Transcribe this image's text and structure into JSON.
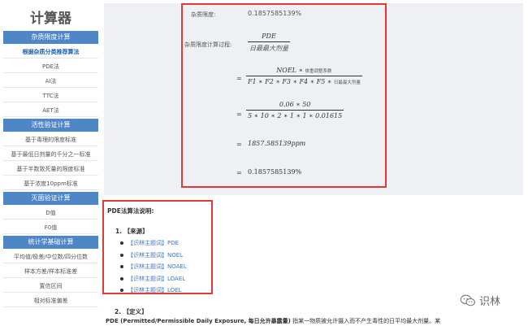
{
  "sidebar": {
    "title": "计算器",
    "menu": [
      {
        "type": "section",
        "label": "杂质限度计算"
      },
      {
        "type": "item",
        "label": "根据杂质分类推荐算法",
        "active": true
      },
      {
        "type": "item",
        "label": "PDE法"
      },
      {
        "type": "item",
        "label": "AI法"
      },
      {
        "type": "item",
        "label": "TTC法"
      },
      {
        "type": "item",
        "label": "AET法"
      },
      {
        "type": "section",
        "label": "活性验证计算"
      },
      {
        "type": "item",
        "label": "基于毒理的限度标准"
      },
      {
        "type": "item",
        "label": "基于最低日剂量的千分之一标准"
      },
      {
        "type": "item",
        "label": "基于半数致死量的限度标准"
      },
      {
        "type": "item",
        "label": "基于浓度10ppm标准"
      },
      {
        "type": "section",
        "label": "灭菌验证计算"
      },
      {
        "type": "item",
        "label": "D值"
      },
      {
        "type": "item",
        "label": "F0值"
      },
      {
        "type": "section",
        "label": "统计学基础计算"
      },
      {
        "type": "item",
        "label": "平均值/极差/中位数/四分位数"
      },
      {
        "type": "item",
        "label": "样本方差/样本标准差"
      },
      {
        "type": "item",
        "label": "置信区间"
      },
      {
        "type": "item",
        "label": "相对标准偏差"
      }
    ]
  },
  "calc": {
    "limit_label": "杂质限度:",
    "limit_value": "0.1857585139%",
    "process_label": "杂质限度计算过程:",
    "eq": "=",
    "step1_num": "PDE",
    "step1_den": "日最最大剂量",
    "step2_num_math": "NOEL",
    "step2_num_star": " ∗ ",
    "step2_num_note": "体重调整系数",
    "step2_den_math": "F1 ∗ F2 ∗ F3 ∗ F4 ∗ F5 ∗ ",
    "step2_den_note": "日最最大剂量",
    "step3_num": "0.06 ∗ 50",
    "step3_den": "5 ∗ 10 ∗ 2 ∗ 1 ∗ 1 ∗ 0.01615",
    "step4": "1857.585139ppm",
    "step5": "0.1857585139%"
  },
  "explanation": {
    "title": "PDE法算法说明:",
    "source_heading": "1. 【来源】",
    "sources": [
      "【识林主题词】PDE",
      "【识林主题词】NOEL",
      "【识林主题词】NOAEL",
      "【识林主题词】LOAEL",
      "【识林主题词】LOEL"
    ]
  },
  "definition": {
    "heading": "2. 【定义】",
    "term": "PDE (Permitted/Permissible Daily Exposure, 每日允许暴露量)",
    "text": " 指某一物质被允许摄入而不产生毒性的日平均最大剂量。某"
  },
  "watermark": {
    "text": "识林",
    "icon": "wechat-icon"
  },
  "colors": {
    "accent": "#4f86c6",
    "highlight_border": "#e53935",
    "link": "#3a78c9",
    "panel_bg": "#eef0f3"
  }
}
